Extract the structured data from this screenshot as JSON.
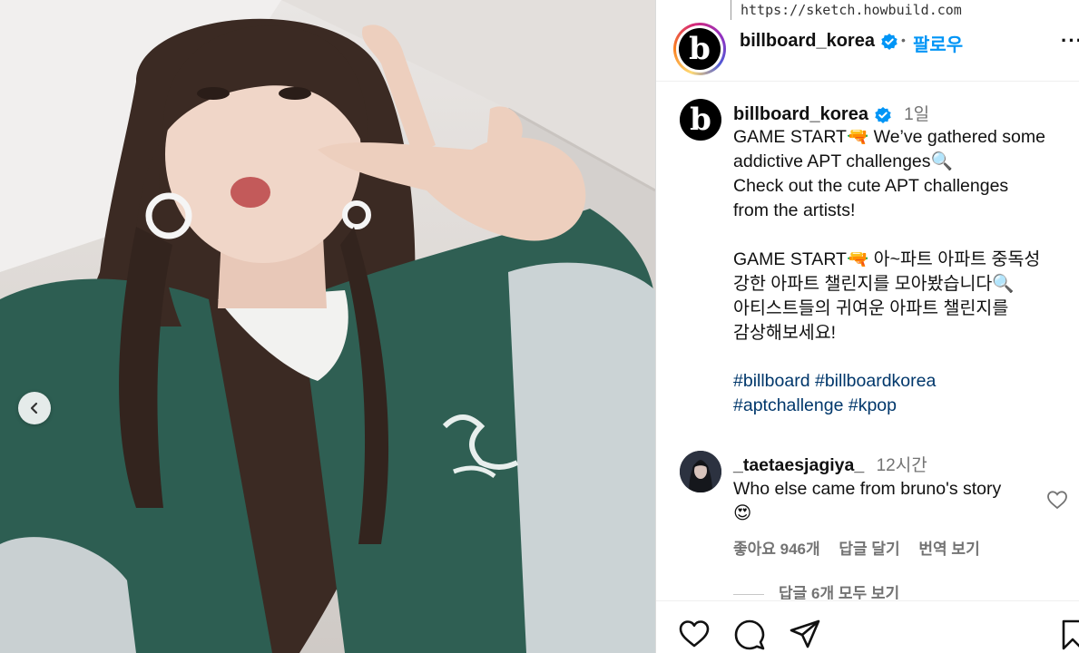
{
  "browser": {
    "url": "https://sketch.howbuild.com"
  },
  "post": {
    "username": "billboard_korea",
    "follow_label": "팔로우",
    "separator": "•",
    "more_label": "···",
    "logo_letter": "b",
    "caption": {
      "time": "1일",
      "lines": [
        "GAME START🔫 We’ve gathered some",
        "addictive APT challenges🔍",
        "Check out the cute APT challenges",
        "from the artists!",
        "",
        "GAME START🔫 아~파트 아파트 중독성",
        "강한 아파트 챌린지를 모아봤습니다🔍",
        "아티스트들의 귀여운 아파트 챌린지를",
        "감상해보세요!"
      ],
      "hashtags": [
        "#billboard",
        "#billboardkorea",
        "#aptchallenge",
        "#kpop"
      ]
    },
    "comment": {
      "username": "_taetaesjagiya_",
      "time": "12시간",
      "text_line1": "Who else came from bruno's story",
      "text_line2": "😍",
      "likes": "좋아요 946개",
      "reply_label": "답글 달기",
      "translate_label": "번역 보기",
      "view_replies": "답글 6개 모두 보기"
    }
  },
  "icons": [
    "chevron-left-icon",
    "verified-icon",
    "heart-icon",
    "comment-icon",
    "share-icon",
    "bookmark-icon"
  ],
  "colors": {
    "accent": "#0095f6",
    "verified": "#0095f6",
    "hashtag": "#00376b",
    "muted": "#737373"
  }
}
